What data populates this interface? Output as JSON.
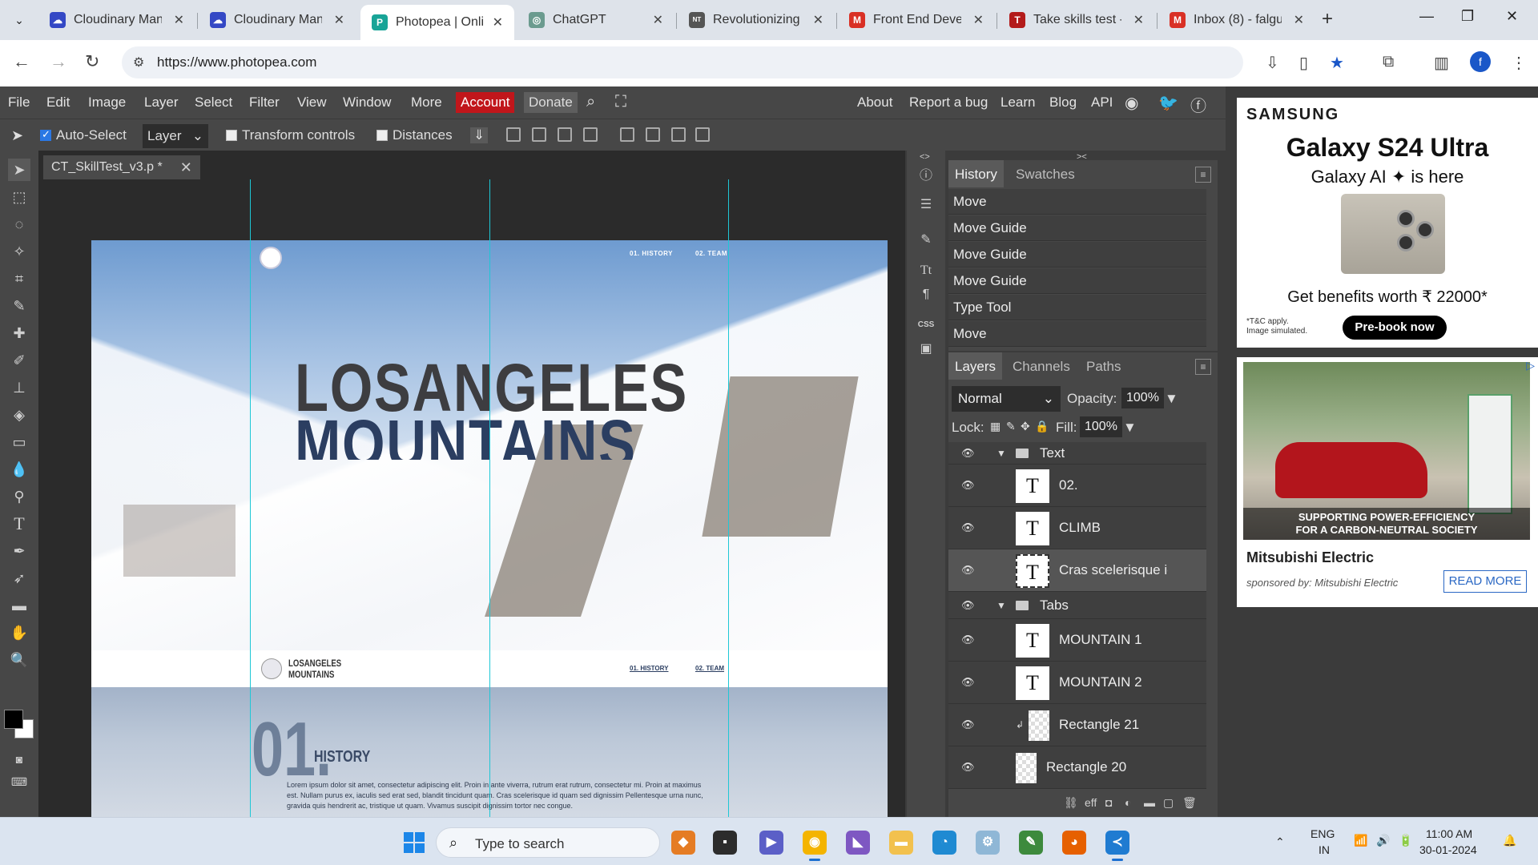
{
  "browser": {
    "tabs": [
      {
        "label": "Cloudinary Mana",
        "icon": "cloudinary-icon",
        "color": "#3448c5"
      },
      {
        "label": "Cloudinary Mana",
        "icon": "cloudinary-icon",
        "color": "#3448c5"
      },
      {
        "label": "Photopea | Onlin",
        "icon": "photopea-icon",
        "color": "#18a497",
        "active": true
      },
      {
        "label": "ChatGPT",
        "icon": "chatgpt-icon",
        "color": "#6b9b8f"
      },
      {
        "label": "Revolutionizing t",
        "icon": "news-icon",
        "color": "#555555"
      },
      {
        "label": "Front End Devel",
        "icon": "gmail-icon",
        "color": "#d93025"
      },
      {
        "label": "Take skills test -",
        "icon": "t-icon",
        "color": "#b31b1b"
      },
      {
        "label": "Inbox (8) - falgu",
        "icon": "gmail-icon",
        "color": "#d93025"
      }
    ],
    "url": "https://www.photopea.com"
  },
  "photopea": {
    "menu": [
      "File",
      "Edit",
      "Image",
      "Layer",
      "Select",
      "Filter",
      "View",
      "Window",
      "More"
    ],
    "account": "Account",
    "donate": "Donate",
    "right_links": [
      "About",
      "Report a bug",
      "Learn",
      "Blog",
      "API"
    ],
    "options": {
      "auto_select": "Auto-Select",
      "layer_select": "Layer",
      "transform_controls": "Transform controls",
      "distances": "Distances"
    },
    "doc_tab": "CT_SkillTest_v3.p *",
    "canvas": {
      "nav1": "01. HISTORY",
      "nav2": "02. TEAM",
      "title_line1": "LOSANGELES",
      "title_line2": "MOUNTAINS",
      "strip_logo_line1": "LOSANGELES",
      "strip_logo_line2": "MOUNTAINS",
      "section_num": "01.",
      "section_title": "HISTORY",
      "section_body": "Lorem ipsum dolor sit amet, consectetur adipiscing elit. Proin in ante viverra, rutrum erat rutrum, consectetur mi. Proin at maximus est. Nullam purus ex, iaculis sed erat sed, blandit tincidunt quam. Cras scelerisque id quam sed dignissim Pellentesque urna nunc, gravida quis hendrerit ac, tristique ut quam. Vivamus suscipit dignissim tortor nec congue."
    },
    "history": {
      "tabs": [
        "History",
        "Swatches"
      ],
      "items": [
        "Move",
        "Move Guide",
        "Move Guide",
        "Move Guide",
        "Type Tool",
        "Move"
      ]
    },
    "layers": {
      "tabs": [
        "Layers",
        "Channels",
        "Paths"
      ],
      "blend_mode": "Normal",
      "opacity_label": "Opacity:",
      "opacity": "100%",
      "lock_label": "Lock:",
      "fill_label": "Fill:",
      "fill": "100%",
      "rows": [
        {
          "name": "Text",
          "type": "group"
        },
        {
          "name": "02.",
          "type": "text"
        },
        {
          "name": "CLIMB",
          "type": "text"
        },
        {
          "name": "Cras scelerisque ic",
          "type": "text",
          "selected": true
        },
        {
          "name": "Tabs",
          "type": "group"
        },
        {
          "name": "MOUNTAIN 1",
          "type": "text"
        },
        {
          "name": "MOUNTAIN 2",
          "type": "text"
        },
        {
          "name": "Rectangle 21",
          "type": "shape"
        },
        {
          "name": "Rectangle 20",
          "type": "shape"
        }
      ]
    }
  },
  "ads": {
    "ad1": {
      "brand": "SAMSUNG",
      "product": "Galaxy S24 Ultra",
      "sub": "Galaxy AI ✦ is here",
      "offer": "Get benefits worth ₹ 22000*",
      "tc_line1": "*T&C apply.",
      "tc_line2": "Image simulated.",
      "button": "Pre-book now"
    },
    "ad2": {
      "caption_line1": "SUPPORTING POWER-EFFICIENCY",
      "caption_line2": "FOR A CARBON-NEUTRAL SOCIETY",
      "title": "Mitsubishi Electric",
      "sponsor": "sponsored by: Mitsubishi Electric",
      "button": "READ MORE"
    }
  },
  "taskbar": {
    "search_placeholder": "Type to search",
    "lang_line1": "ENG",
    "lang_line2": "IN",
    "time": "11:00 AM",
    "date": "30-01-2024"
  }
}
